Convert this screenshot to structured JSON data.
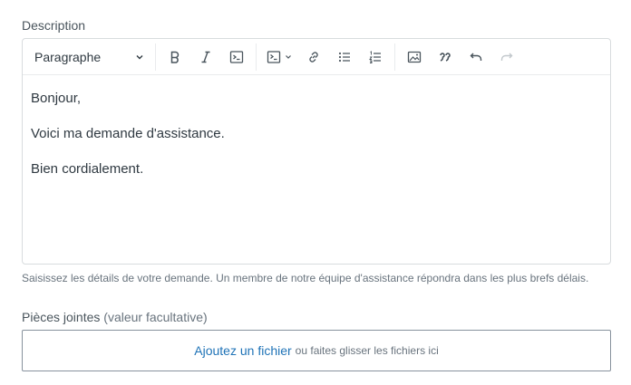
{
  "description": {
    "label": "Description",
    "toolbar": {
      "block_format": "Paragraphe",
      "buttons": [
        "bold-icon",
        "italic-icon",
        "code-icon",
        "code-block-icon",
        "link-icon",
        "bulleted-list-icon",
        "numbered-list-icon",
        "image-icon",
        "quote-icon",
        "undo-icon",
        "redo-icon"
      ]
    },
    "content": {
      "p1": "Bonjour,",
      "p2": "Voici ma demande d'assistance.",
      "p3": "Bien cordialement."
    },
    "hint": "Saisissez les détails de votre demande. Un membre de notre équipe d'assistance répondra dans les plus brefs délais."
  },
  "attachments": {
    "label": "Pièces jointes",
    "optional": "(valeur facultative)",
    "link": "Ajoutez un fichier",
    "drop_text": "ou faites glisser les fichiers ici"
  },
  "colors": {
    "link": "#1f73b7",
    "text": "#2f3941",
    "muted": "#68737d",
    "border": "#d8dcde"
  }
}
